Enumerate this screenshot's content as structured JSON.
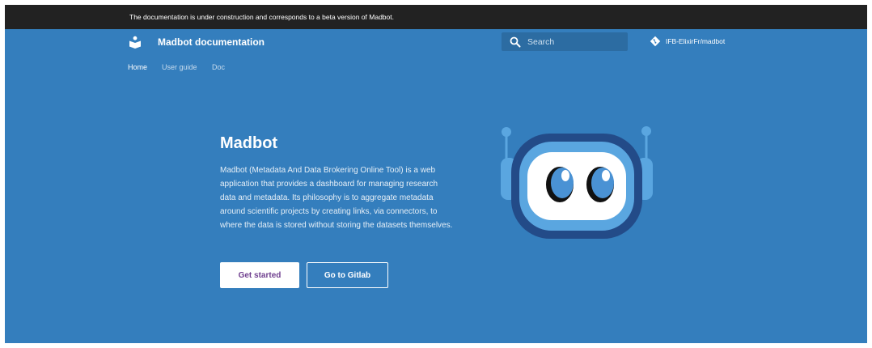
{
  "announcement": {
    "text": "The documentation is under construction and corresponds to a beta version of Madbot."
  },
  "header": {
    "logo_icon": "book-person-icon",
    "title": "Madbot documentation",
    "search": {
      "placeholder": "Search",
      "icon": "search-icon"
    },
    "repo": {
      "icon": "git-diamond-icon",
      "label": "IFB-ElixirFr/madbot"
    }
  },
  "tabs": [
    {
      "label": "Home",
      "active": true
    },
    {
      "label": "User guide",
      "active": false
    },
    {
      "label": "Doc",
      "active": false
    }
  ],
  "hero": {
    "title": "Madbot",
    "description": "Madbot (Metadata And Data Brokering Online Tool) is a web application that provides a dashboard for managing research data and metadata. Its philosophy is to aggregate metadata around scientific projects by creating links, via connectors, to where the data is stored without storing the datasets themselves.",
    "primary_button": "Get started",
    "secondary_button": "Go to Gitlab",
    "illustration": "robot-mascot"
  },
  "colors": {
    "primary": "#347ebd",
    "announcement_bg": "#222222",
    "search_bg": "#2c6ca2",
    "accent_text": "#6f3f8f"
  }
}
